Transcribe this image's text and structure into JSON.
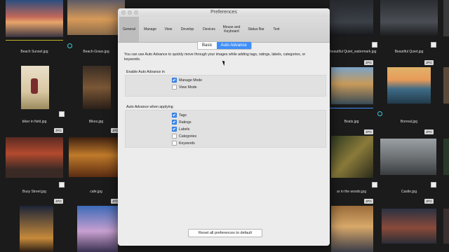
{
  "window": {
    "title": "Preferences",
    "tabs": [
      "General",
      "Manage",
      "View",
      "Develop",
      "Devices",
      "Mouse and\nKeyboard",
      "Status Bar",
      "Text"
    ],
    "active_tab": "General"
  },
  "mode_toggle": {
    "basic": "Basic",
    "advanced": "Auto Advance"
  },
  "description": "You can use Auto Advance to quickly move through your images while adding tags, ratings, labels, categories, or keywords.",
  "enable_section": {
    "label": "Enable Auto Advance in",
    "options": [
      {
        "label": "Manage Mode",
        "checked": true
      },
      {
        "label": "View Mode",
        "checked": false
      }
    ]
  },
  "apply_section": {
    "label": "Auto Advance when applying",
    "options": [
      {
        "label": "Tags",
        "checked": true
      },
      {
        "label": "Ratings",
        "checked": true
      },
      {
        "label": "Labels",
        "checked": true
      },
      {
        "label": "Categories",
        "checked": false
      },
      {
        "label": "Keywords",
        "checked": false
      }
    ]
  },
  "reset_button": "Reset all preferences to default",
  "thumbnails": {
    "badge": "JPG",
    "labels": [
      "Beach Sunset.jpg",
      "Beach-Grass.jpg",
      "beautiful Quiet_watermark.jpg",
      "Beautiful Quiet.jpg",
      "biker in field.jpg",
      "Bikes.jpg",
      "Boats.jpg",
      "Borreal.jpg",
      "Busy Street.jpg",
      "cafe.jpg",
      "ar in the woods.jpg",
      "Castle.jpg"
    ]
  },
  "colors": {
    "accent": "#3f8ef7",
    "window_bg": "#ececec",
    "app_bg": "#1b1b1b"
  }
}
